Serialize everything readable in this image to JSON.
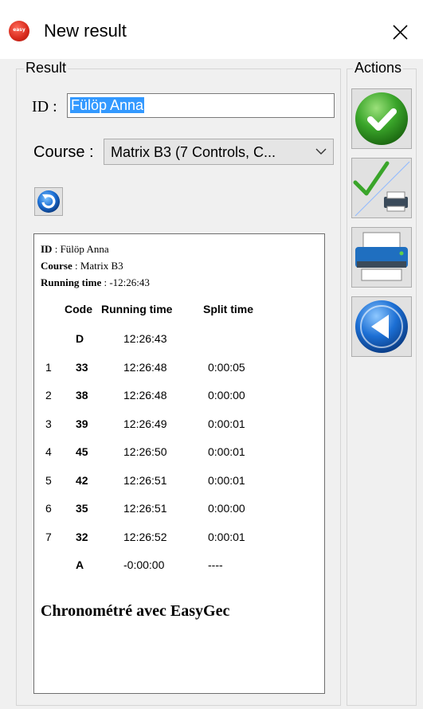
{
  "window": {
    "title": "New result",
    "icon_text": "easy"
  },
  "result_group": {
    "legend": "Result",
    "id_label": "ID :",
    "id_value": "Fülöp Anna",
    "course_label": "Course :",
    "course_value": "Matrix B3 (7 Controls, C..."
  },
  "actions_group": {
    "legend": "Actions"
  },
  "report": {
    "id_label": "ID",
    "id_value": " : Fülöp Anna",
    "course_label": "Course",
    "course_value": " : Matrix B3",
    "running_label": "Running time",
    "running_value": " : -12:26:43",
    "headers": {
      "code": "Code",
      "running": "Running time",
      "split": "Split time"
    },
    "rows": [
      {
        "num": "",
        "code": "D",
        "running": "12:26:43",
        "split": ""
      },
      {
        "num": "1",
        "code": "33",
        "running": "12:26:48",
        "split": "0:00:05"
      },
      {
        "num": "2",
        "code": "38",
        "running": "12:26:48",
        "split": "0:00:00"
      },
      {
        "num": "3",
        "code": "39",
        "running": "12:26:49",
        "split": "0:00:01"
      },
      {
        "num": "4",
        "code": "45",
        "running": "12:26:50",
        "split": "0:00:01"
      },
      {
        "num": "5",
        "code": "42",
        "running": "12:26:51",
        "split": "0:00:01"
      },
      {
        "num": "6",
        "code": "35",
        "running": "12:26:51",
        "split": "0:00:00"
      },
      {
        "num": "7",
        "code": "32",
        "running": "12:26:52",
        "split": "0:00:01"
      },
      {
        "num": "",
        "code": "A",
        "running": "-0:00:00",
        "split": "----"
      }
    ],
    "footer": "Chronométré avec EasyGec"
  },
  "colors": {
    "accent_green": "#3aa52a",
    "accent_blue": "#1c6fd4",
    "selection": "#3399ff"
  }
}
